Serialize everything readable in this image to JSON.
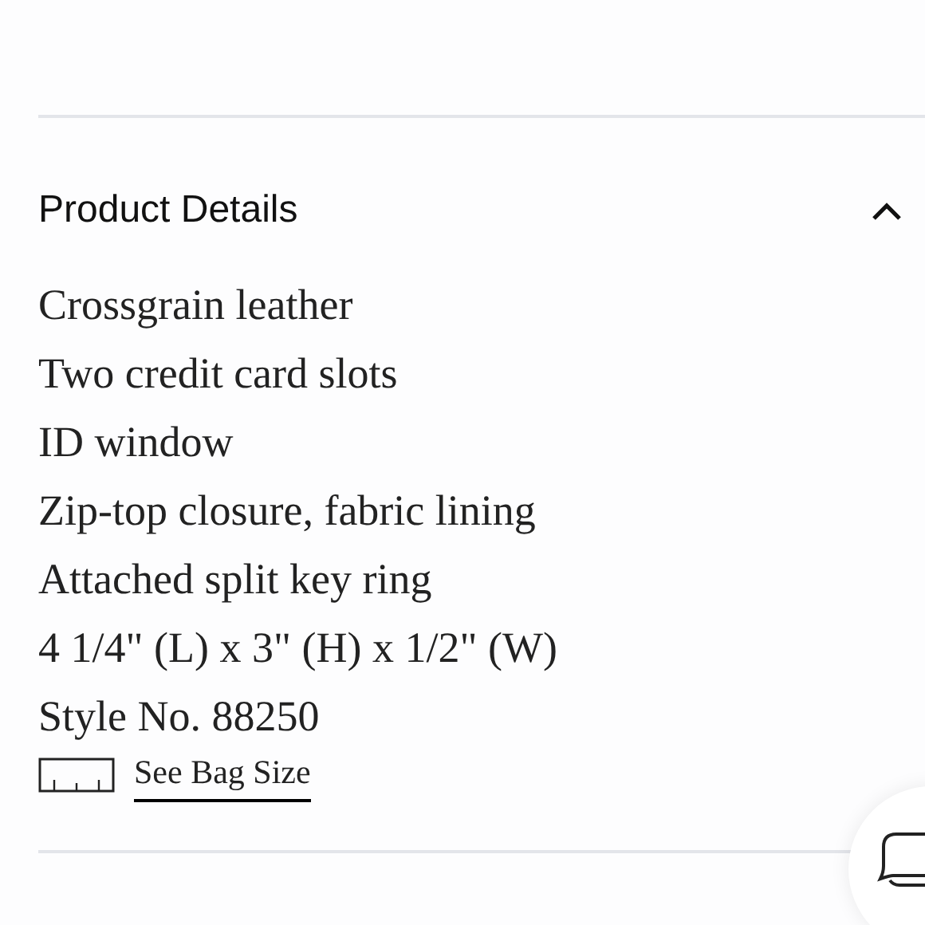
{
  "section": {
    "title": "Product Details",
    "expanded": true,
    "details": [
      "Crossgrain leather",
      "Two credit card slots",
      "ID window",
      "Zip-top closure, fabric lining",
      "Attached split key ring",
      "4 1/4\" (L) x 3\" (H) x 1/2\" (W)",
      "Style No. 88250"
    ],
    "size_link": "See Bag Size"
  }
}
